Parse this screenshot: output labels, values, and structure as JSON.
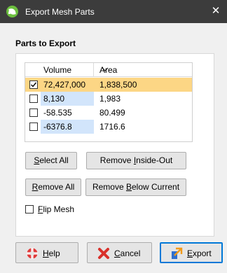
{
  "window": {
    "title": "Export Mesh Parts",
    "close_glyph": "✕"
  },
  "parts_section": {
    "title": "Parts to Export",
    "columns": [
      "Volume",
      "Area"
    ],
    "sort_indicator": "chevron-down-icon",
    "rows": [
      {
        "checked": true,
        "volume": "72,427,000",
        "area": "1,838,500"
      },
      {
        "checked": false,
        "volume": "8,130",
        "area": "1,983"
      },
      {
        "checked": false,
        "volume": "-58.535",
        "area": "80.499"
      },
      {
        "checked": false,
        "volume": "-6376.8",
        "area": "1716.6"
      }
    ]
  },
  "buttons": {
    "select_all": {
      "pre": "",
      "mn": "S",
      "post": "elect All"
    },
    "remove_inside_out": {
      "pre": "Remove ",
      "mn": "I",
      "post": "nside-Out"
    },
    "remove_all": {
      "pre": "",
      "mn": "R",
      "post": "emove All"
    },
    "remove_below": {
      "pre": "Remove ",
      "mn": "B",
      "post": "elow Current"
    }
  },
  "flip_mesh": {
    "checked": false,
    "pre": "",
    "mn": "F",
    "post": "lip Mesh"
  },
  "footer": {
    "help": {
      "pre": "",
      "mn": "H",
      "post": "elp"
    },
    "cancel": {
      "pre": "",
      "mn": "C",
      "post": "ancel"
    },
    "export": {
      "pre": "",
      "mn": "E",
      "post": "xport"
    }
  },
  "colors": {
    "titlebar": "#3c3c3c",
    "selected_row": "#fcd685",
    "volume_highlight": "#d2e5fb",
    "default_button_border": "#0078d7"
  }
}
